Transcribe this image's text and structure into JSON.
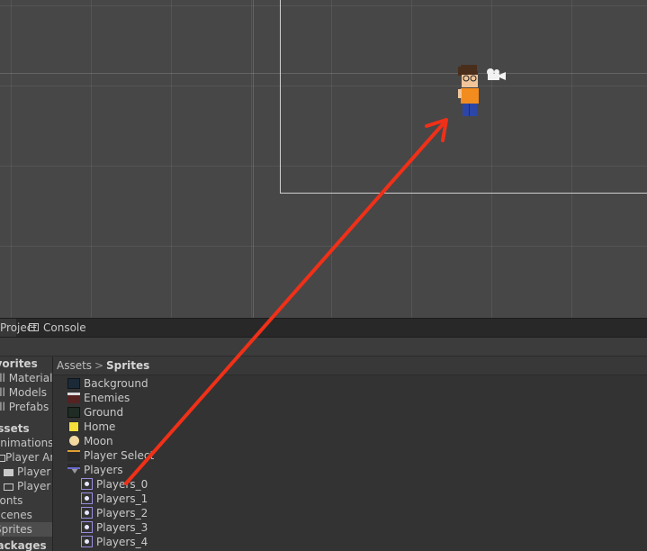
{
  "tabs": {
    "project": "Project",
    "console": "Console"
  },
  "sidebar": {
    "items": [
      {
        "label": "Favorites",
        "bold": true
      },
      {
        "label": "All Materials"
      },
      {
        "label": "All Models"
      },
      {
        "label": "All Prefabs"
      },
      {
        "label": "Assets",
        "bold": true
      },
      {
        "label": "Animations"
      },
      {
        "label": "Player Animations"
      },
      {
        "label": "Player"
      },
      {
        "label": "Player"
      },
      {
        "label": "Fonts"
      },
      {
        "label": "Scenes"
      },
      {
        "label": "Sprites",
        "selected": true
      },
      {
        "label": "Packages",
        "bold": true
      }
    ]
  },
  "breadcrumb": {
    "root": "Assets",
    "separator": ">",
    "current": "Sprites"
  },
  "assets": [
    {
      "label": "Background",
      "icon": "background-thumbnail"
    },
    {
      "label": "Enemies",
      "icon": "enemies-thumbnail"
    },
    {
      "label": "Ground",
      "icon": "ground-thumbnail"
    },
    {
      "label": "Home",
      "icon": "home-thumbnail"
    },
    {
      "label": "Moon",
      "icon": "moon-thumbnail"
    },
    {
      "label": "Player Select",
      "icon": "player-select-thumbnail"
    },
    {
      "label": "Players",
      "icon": "players-thumbnail",
      "expanded": true
    },
    {
      "label": "Players_0",
      "icon": "sprite-icon"
    },
    {
      "label": "Players_1",
      "icon": "sprite-icon"
    },
    {
      "label": "Players_2",
      "icon": "sprite-icon"
    },
    {
      "label": "Players_3",
      "icon": "sprite-icon"
    },
    {
      "label": "Players_4",
      "icon": "sprite-icon"
    }
  ],
  "colors": {
    "annotation_arrow": "#f03018",
    "camera_bounds": "#cfcfcf",
    "selection": "#4d4d4d"
  }
}
